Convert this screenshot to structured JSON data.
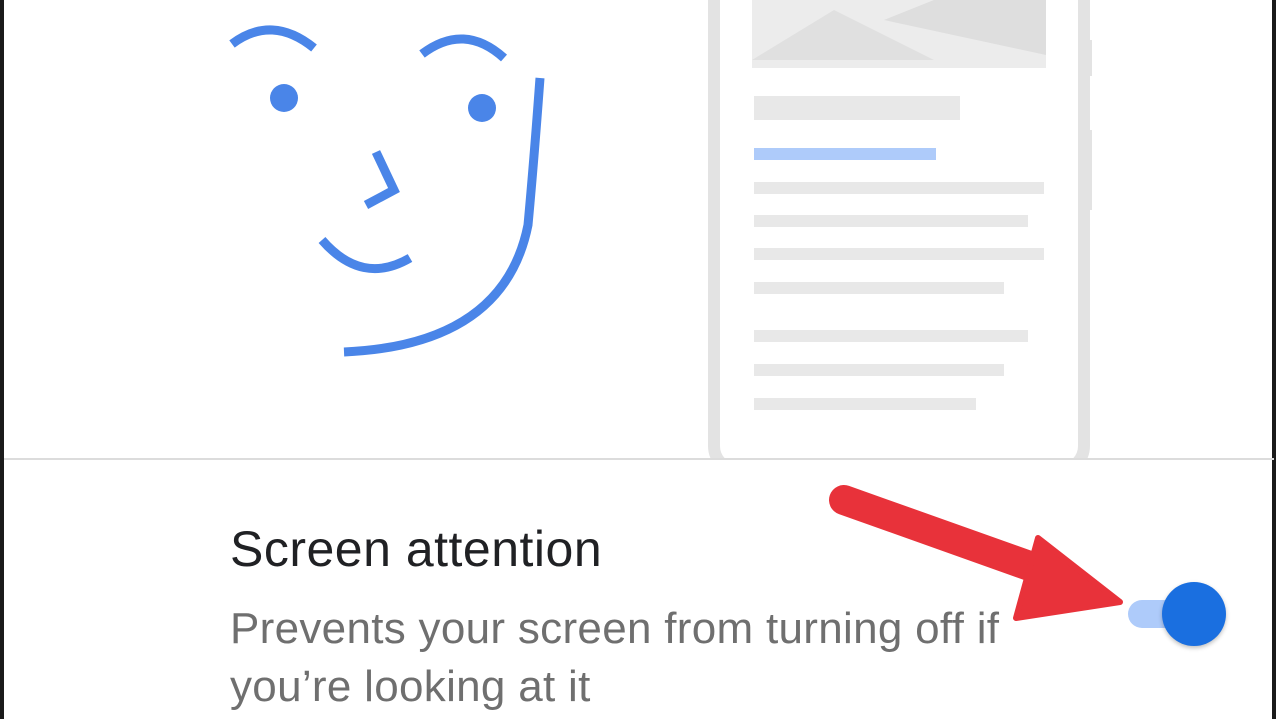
{
  "setting": {
    "title": "Screen attention",
    "description": "Prevents your screen from turning off if you’re looking at it",
    "toggle_state": "on"
  },
  "colors": {
    "face_stroke": "#4a85e8",
    "toggle_thumb": "#1a6fe0",
    "toggle_track": "#aecbfa",
    "arrow": "#e8323a",
    "phone_placeholder": "#e8e8e8",
    "phone_highlight": "#aecbfa"
  },
  "icons": {
    "face": "face-illustration-icon",
    "phone": "phone-illustration-icon",
    "arrow": "red-arrow-annotation"
  }
}
